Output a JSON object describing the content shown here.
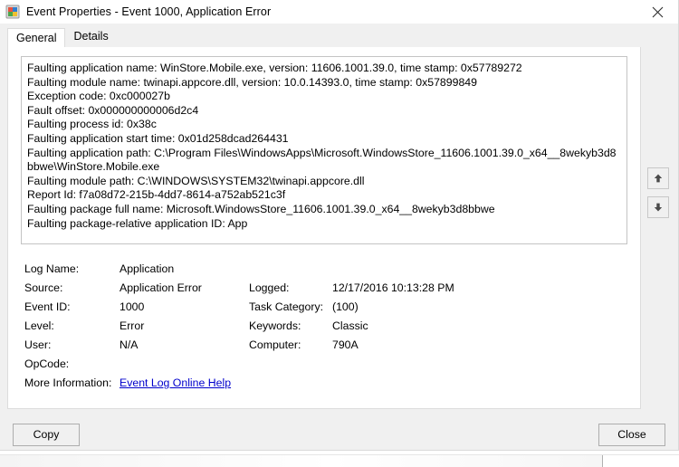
{
  "window": {
    "title": "Event Properties - Event 1000, Application Error",
    "icon": "event-properties-icon",
    "close_icon": "close-icon"
  },
  "tabs": [
    {
      "label": "General",
      "active": true
    },
    {
      "label": "Details",
      "active": false
    }
  ],
  "description": "Faulting application name: WinStore.Mobile.exe, version: 11606.1001.39.0, time stamp: 0x57789272\nFaulting module name: twinapi.appcore.dll, version: 10.0.14393.0, time stamp: 0x57899849\nException code: 0xc000027b\nFault offset: 0x000000000006d2c4\nFaulting process id: 0x38c\nFaulting application start time: 0x01d258dcad264431\nFaulting application path: C:\\Program Files\\WindowsApps\\Microsoft.WindowsStore_11606.1001.39.0_x64__8wekyb3d8bbwe\\WinStore.Mobile.exe\nFaulting module path: C:\\WINDOWS\\SYSTEM32\\twinapi.appcore.dll\nReport Id: f7a08d72-215b-4dd7-8614-a752ab521c3f\nFaulting package full name: Microsoft.WindowsStore_11606.1001.39.0_x64__8wekyb3d8bbwe\nFaulting package-relative application ID: App",
  "details": {
    "rows": [
      {
        "label": "Log Name:",
        "value": "Application",
        "label2": "",
        "value2": ""
      },
      {
        "label": "Source:",
        "value": "Application Error",
        "label2": "Logged:",
        "value2": "12/17/2016 10:13:28 PM"
      },
      {
        "label": "Event ID:",
        "value": "1000",
        "label2": "Task Category:",
        "value2": "(100)"
      },
      {
        "label": "Level:",
        "value": "Error",
        "label2": "Keywords:",
        "value2": "Classic"
      },
      {
        "label": "User:",
        "value": "N/A",
        "label2": "Computer:",
        "value2": "790A"
      },
      {
        "label": "OpCode:",
        "value": "",
        "label2": "",
        "value2": ""
      }
    ],
    "more_information_label": "More Information:",
    "more_information_link": "Event Log Online Help"
  },
  "nav": {
    "up_icon": "arrow-up-icon",
    "down_icon": "arrow-down-icon"
  },
  "buttons": {
    "copy": "Copy",
    "close": "Close"
  }
}
